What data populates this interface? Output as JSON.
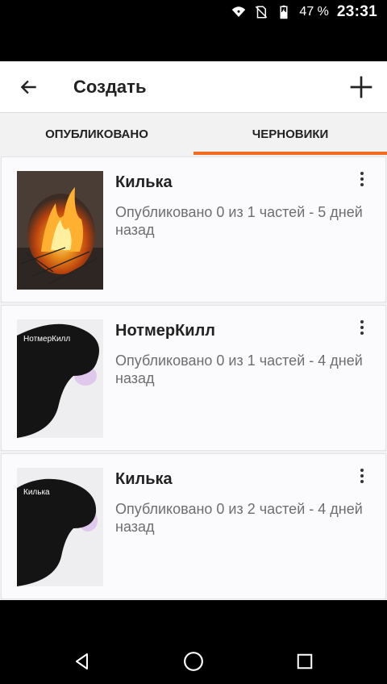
{
  "status_bar": {
    "battery_percent": "47 %",
    "time": "23:31",
    "icons": [
      "wifi-icon",
      "no-sim-icon",
      "battery-charging-icon"
    ]
  },
  "toolbar": {
    "title": "Создать",
    "back_icon": "arrow-left-icon",
    "add_icon": "plus-icon"
  },
  "tabs": [
    {
      "label": "ОПУБЛИКОВАНО",
      "active": false
    },
    {
      "label": "ЧЕРНОВИКИ",
      "active": true
    }
  ],
  "accent_color": "#f26a21",
  "stories": [
    {
      "title": "Килька",
      "subtitle": "Опубликовано 0 из 1 частей - 5 дней назад",
      "cover": "fire-image",
      "cover_text": ""
    },
    {
      "title": "НотмерКилл",
      "subtitle": "Опубликовано 0 из 1 частей - 4 дней назад",
      "cover": "silhouette-image",
      "cover_text": "НотмерКилл"
    },
    {
      "title": "Килька",
      "subtitle": "Опубликовано 0 из 2 частей - 4 дней назад",
      "cover": "silhouette-image",
      "cover_text": "Килька"
    }
  ],
  "nav_bar": {
    "icons": [
      "back-triangle-icon",
      "home-circle-icon",
      "recents-square-icon"
    ]
  }
}
